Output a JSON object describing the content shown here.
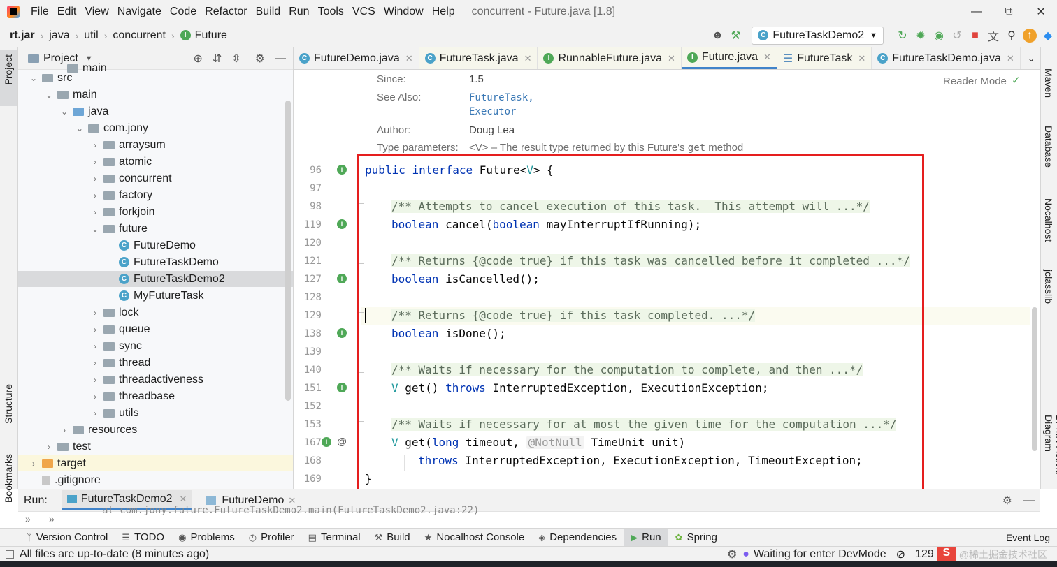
{
  "app": {
    "window_title": "concurrent - Future.java [1.8]",
    "menu": [
      "File",
      "Edit",
      "View",
      "Navigate",
      "Code",
      "Refactor",
      "Build",
      "Run",
      "Tools",
      "VCS",
      "Window",
      "Help"
    ]
  },
  "breadcrumb": [
    "rt.jar",
    "java",
    "util",
    "concurrent",
    "Future"
  ],
  "toolbar": {
    "run_config": "FutureTaskDemo2"
  },
  "left_strip": {
    "project": "Project",
    "structure": "Structure",
    "bookmarks": "Bookmarks"
  },
  "project_panel": {
    "title": "Project",
    "rows": [
      {
        "label": "main",
        "kind": "folder"
      },
      {
        "label": "src",
        "kind": "folder"
      },
      {
        "label": "main",
        "kind": "folder"
      },
      {
        "label": "java",
        "kind": "folder-blue"
      },
      {
        "label": "com.jony",
        "kind": "package"
      },
      {
        "label": "arraysum",
        "kind": "package"
      },
      {
        "label": "atomic",
        "kind": "package"
      },
      {
        "label": "concurrent",
        "kind": "package"
      },
      {
        "label": "factory",
        "kind": "package"
      },
      {
        "label": "forkjoin",
        "kind": "package"
      },
      {
        "label": "future",
        "kind": "package"
      },
      {
        "label": "FutureDemo",
        "kind": "class"
      },
      {
        "label": "FutureTaskDemo",
        "kind": "class"
      },
      {
        "label": "FutureTaskDemo2",
        "kind": "class"
      },
      {
        "label": "MyFutureTask",
        "kind": "class"
      },
      {
        "label": "lock",
        "kind": "package"
      },
      {
        "label": "queue",
        "kind": "package"
      },
      {
        "label": "sync",
        "kind": "package"
      },
      {
        "label": "thread",
        "kind": "package"
      },
      {
        "label": "threadactiveness",
        "kind": "package"
      },
      {
        "label": "threadbase",
        "kind": "package"
      },
      {
        "label": "utils",
        "kind": "package"
      },
      {
        "label": "resources",
        "kind": "folder"
      },
      {
        "label": "test",
        "kind": "folder"
      },
      {
        "label": "target",
        "kind": "folder-orange"
      },
      {
        "label": ".gitignore",
        "kind": "file"
      }
    ]
  },
  "editor_tabs": [
    {
      "label": "FutureDemo.java",
      "icon": "C"
    },
    {
      "label": "FutureTask.java",
      "icon": "C"
    },
    {
      "label": "RunnableFuture.java",
      "icon": "I"
    },
    {
      "label": "Future.java",
      "icon": "I"
    },
    {
      "label": "FutureTask",
      "icon": "struct"
    },
    {
      "label": "FutureTaskDemo.java",
      "icon": "C"
    }
  ],
  "doc": {
    "since_label": "Since:",
    "since_value": "1.5",
    "see_also_label": "See Also:",
    "see_also_1": "FutureTask,",
    "see_also_2": "Executor",
    "author_label": "Author:",
    "author_value": "Doug Lea",
    "type_params_label": "Type parameters:",
    "type_params_text_1": "<V> – The result type returned by this Future's ",
    "type_params_code": "get",
    "type_params_text_2": " method",
    "reader_mode": "Reader Mode"
  },
  "code": {
    "line_numbers": [
      "96",
      "97",
      "98",
      "119",
      "120",
      "121",
      "127",
      "128",
      "129",
      "138",
      "139",
      "140",
      "151",
      "152",
      "153",
      "167",
      "168",
      "169"
    ],
    "l96_kw1": "public",
    "l96_kw2": "interface",
    "l96_name": " Future<",
    "l96_tp": "V",
    "l96_end": "> {",
    "l98": "/** Attempts to cancel execution of this task.  This attempt will ...*/",
    "l119_kw": "boolean",
    "l119_name": " cancel(",
    "l119_kw2": "boolean",
    "l119_end": " mayInterruptIfRunning);",
    "l121": "/** Returns {@code true} if this task was cancelled before it completed ...*/",
    "l127_kw": "boolean",
    "l127_name": " isCancelled();",
    "l129": "/** Returns {@code true} if this task completed. ...*/",
    "l138_kw": "boolean",
    "l138_name": " isDone();",
    "l140": "/** Waits if necessary for the computation to complete, and then ...*/",
    "l151_tp": "V",
    "l151_name": " get() ",
    "l151_kw": "throws",
    "l151_end": " InterruptedException, ExecutionException;",
    "l153": "/** Waits if necessary for at most the given time for the computation ...*/",
    "l167_tp": "V",
    "l167_name": " get(",
    "l167_kw": "long",
    "l167_mid": " timeout, ",
    "l167_ann": "@NotNull",
    "l167_end": " TimeUnit unit)",
    "l168_kw": "throws",
    "l168_end": " InterruptedException, ExecutionException, TimeoutException;",
    "l169": "}"
  },
  "right_strip": [
    "Maven",
    "Database",
    "Nocalhost",
    "jclasslib",
    "BPMN-Activiti-Diagram"
  ],
  "run_bar": {
    "label": "Run:",
    "tab1": "FutureTaskDemo2",
    "tab2": "FutureDemo",
    "sub_text": "at com.jony.future.FutureTaskDemo2.main(FutureTaskDemo2.java:22)"
  },
  "tool_windows": [
    "Version Control",
    "TODO",
    "Problems",
    "Profiler",
    "Terminal",
    "Build",
    "Nocalhost Console",
    "Dependencies",
    "Run",
    "Spring"
  ],
  "status": {
    "message": "All files are up-to-date (8 minutes ago)",
    "devmode": "Waiting for enter DevMode",
    "position": "129",
    "event_log": "Event Log",
    "watermark": "@稀土掘金技术社区"
  },
  "colors": {
    "accent": "#4083c9",
    "highlight_box": "#e51e1e",
    "keyword": "#0033b3",
    "comment_bg": "#eef6e8"
  }
}
